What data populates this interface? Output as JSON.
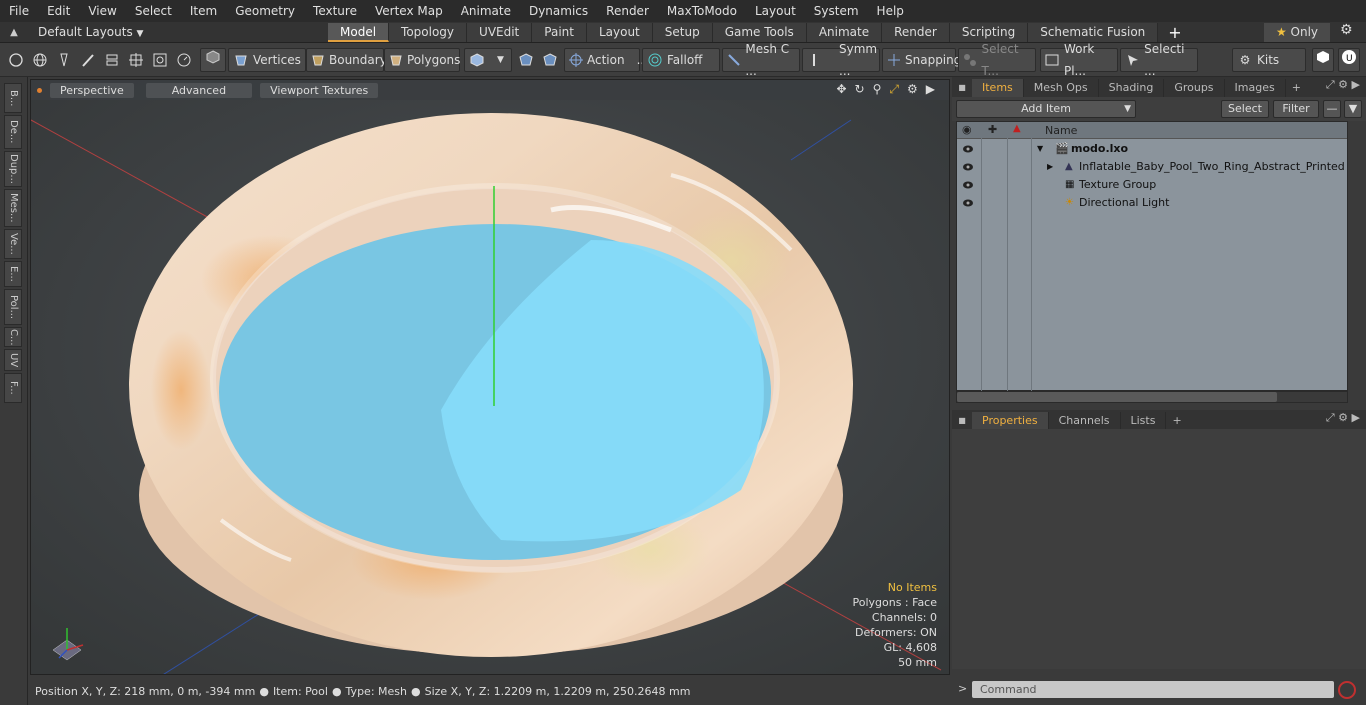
{
  "menu": [
    "File",
    "Edit",
    "View",
    "Select",
    "Item",
    "Geometry",
    "Texture",
    "Vertex Map",
    "Animate",
    "Dynamics",
    "Render",
    "MaxToModo",
    "Layout",
    "System",
    "Help"
  ],
  "layout": {
    "preset": "Default Layouts",
    "tabs": [
      "Model",
      "Topology",
      "UVEdit",
      "Paint",
      "Layout",
      "Setup",
      "Game Tools",
      "Animate",
      "Render",
      "Scripting",
      "Schematic Fusion"
    ],
    "active": "Model",
    "only_label": "Only"
  },
  "toolbar": {
    "vertices": "Vertices",
    "boundary": "Boundary",
    "polygons": "Polygons",
    "action": "Action",
    "falloff": "Falloff",
    "meshc": "Mesh C ...",
    "symm": "Symm ...",
    "snapping": "Snapping",
    "selectt": "Select T...",
    "workpl": "Work Pl...",
    "selecti": "Selecti ...",
    "kits": "Kits"
  },
  "lefttabs": [
    "B...",
    "De...",
    "Dup...",
    "Mes...",
    "Ve...",
    "E...",
    "Pol...",
    "C...",
    "UV",
    "F..."
  ],
  "viewport": {
    "view": "Perspective",
    "shading": "Advanced",
    "textures": "Viewport Textures",
    "info": {
      "items": "No Items",
      "polygons": "Polygons : Face",
      "channels": "Channels: 0",
      "deformers": "Deformers: ON",
      "gl": "GL: 4,608",
      "scale": "50 mm"
    }
  },
  "status": {
    "position": "Position X, Y, Z:   218 mm, 0 m, -394 mm",
    "item": "Item:  Pool",
    "type": "Type:  Mesh",
    "size": "Size X, Y, Z:   1.2209 m, 1.2209 m, 250.2648 mm"
  },
  "items_panel": {
    "tabs": [
      "Items",
      "Mesh Ops",
      "Shading",
      "Groups",
      "Images"
    ],
    "active": "Items",
    "add_item": "Add Item",
    "select": "Select",
    "filter": "Filter",
    "col_name": "Name",
    "rows": [
      {
        "name": "modo.lxo"
      },
      {
        "name": "Inflatable_Baby_Pool_Two_Ring_Abstract_Printed"
      },
      {
        "name": "Texture Group"
      },
      {
        "name": "Directional Light"
      }
    ]
  },
  "props_panel": {
    "tabs": [
      "Properties",
      "Channels",
      "Lists"
    ],
    "active": "Properties"
  },
  "command": {
    "placeholder": "Command"
  },
  "colors": {
    "accent": "#f0a030",
    "water": "#6fcdf0",
    "ring": "#f0e4d8"
  }
}
